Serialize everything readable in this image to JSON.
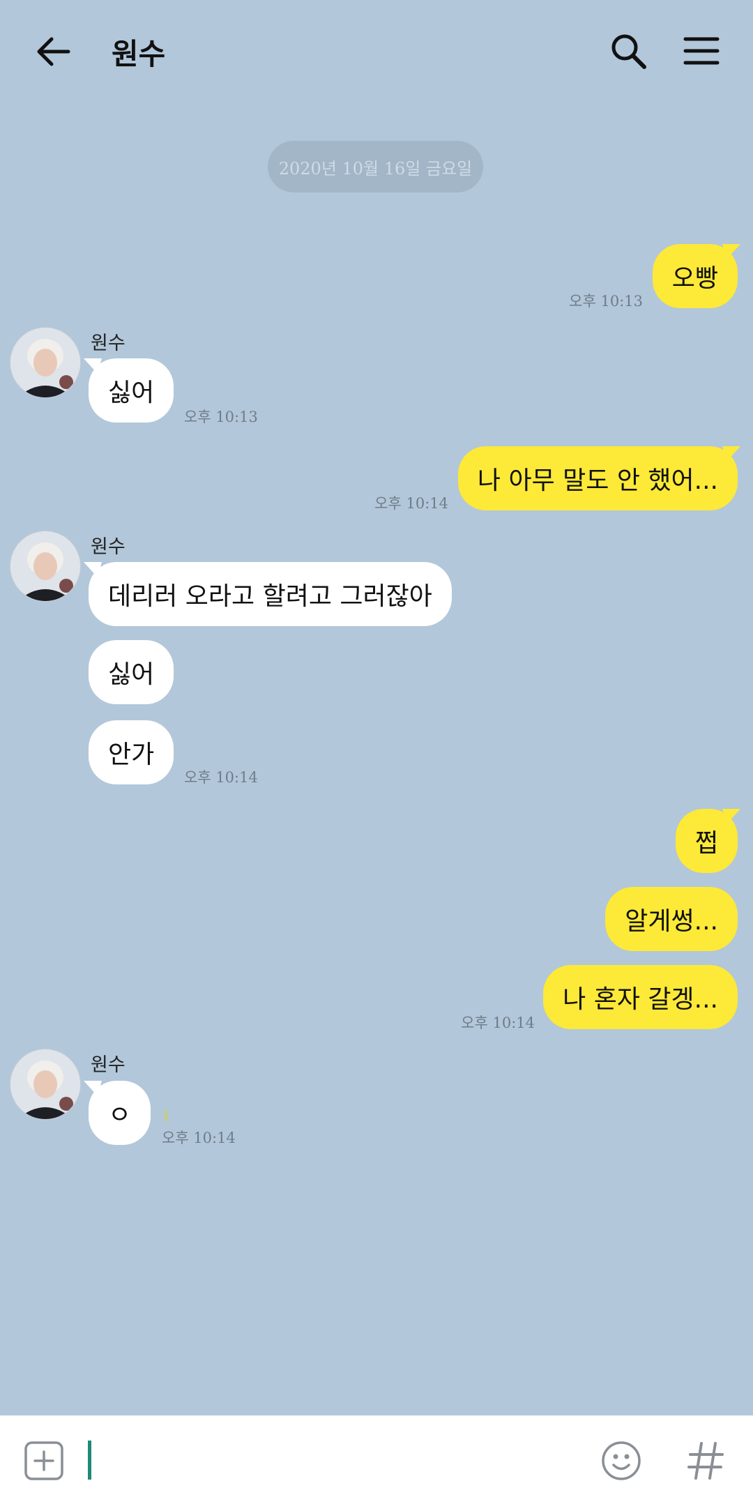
{
  "header": {
    "title": "원수",
    "back_icon": "arrow-left-icon",
    "search_icon": "search-icon",
    "menu_icon": "hamburger-menu-icon"
  },
  "date_divider": "2020년 10월 16일 금요일",
  "messages": [
    {
      "from": "me",
      "text": "오빵",
      "time": "오후 10:13"
    },
    {
      "from": "them",
      "sender": "원수",
      "text": "싫어",
      "time": "오후 10:13"
    },
    {
      "from": "me",
      "text": "나 아무 말도 안 했어...",
      "time": "오후 10:14"
    },
    {
      "from": "them",
      "sender": "원수",
      "text": "데리러 오라고 할려고 그러잖아"
    },
    {
      "from": "them",
      "text": "싫어"
    },
    {
      "from": "them",
      "text": "안가",
      "time": "오후 10:14"
    },
    {
      "from": "me",
      "text": "쩝"
    },
    {
      "from": "me",
      "text": "알게썽..."
    },
    {
      "from": "me",
      "text": "나 혼자 갈겡...",
      "time": "오후 10:14"
    },
    {
      "from": "them",
      "sender": "원수",
      "text": "ㅇ",
      "unread": "1",
      "time": "오후 10:14"
    }
  ],
  "composer": {
    "attach_icon": "plus-square-icon",
    "emoji_icon": "smiley-icon",
    "hashtag_icon": "hashtag-icon"
  },
  "colors": {
    "background": "#b2c7da",
    "my_bubble": "#fde937",
    "their_bubble": "#ffffff",
    "date_pill": "#a2b6c8"
  }
}
